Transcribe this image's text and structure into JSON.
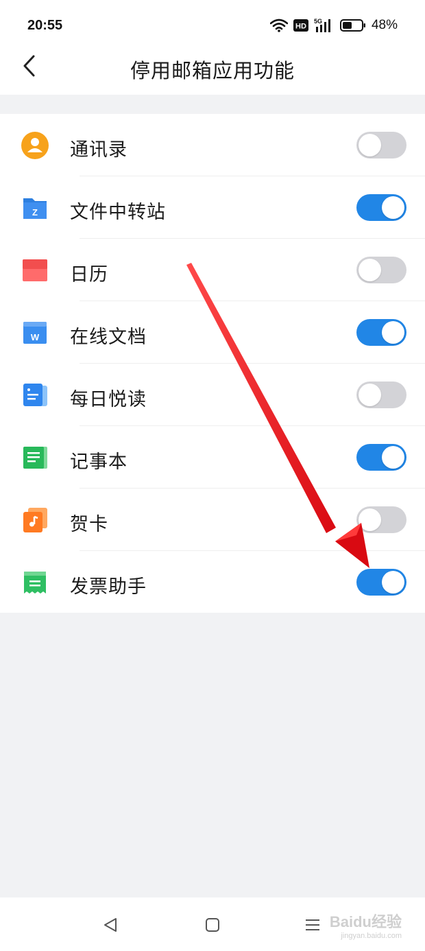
{
  "status_bar": {
    "time": "20:55",
    "hd_badge": "HD",
    "network": "5G",
    "battery": "48%"
  },
  "header": {
    "title": "停用邮箱应用功能"
  },
  "apps": [
    {
      "label": "通讯录",
      "icon": "contacts-icon",
      "enabled": false
    },
    {
      "label": "文件中转站",
      "icon": "file-transfer-icon",
      "icon_letter": "Z",
      "enabled": true
    },
    {
      "label": "日历",
      "icon": "calendar-icon",
      "enabled": false
    },
    {
      "label": "在线文档",
      "icon": "online-docs-icon",
      "icon_letter": "W",
      "enabled": true
    },
    {
      "label": "每日悦读",
      "icon": "daily-reading-icon",
      "enabled": false
    },
    {
      "label": "记事本",
      "icon": "notepad-icon",
      "enabled": true
    },
    {
      "label": "贺卡",
      "icon": "greeting-card-icon",
      "enabled": false
    },
    {
      "label": "发票助手",
      "icon": "invoice-assistant-icon",
      "enabled": true
    }
  ],
  "colors": {
    "toggle_on": "#2186e6",
    "toggle_off": "#d3d3d7",
    "annotation_arrow": "#e8121a"
  },
  "watermark": {
    "main": "Baidu经验",
    "sub": "jingyan.baidu.com"
  }
}
